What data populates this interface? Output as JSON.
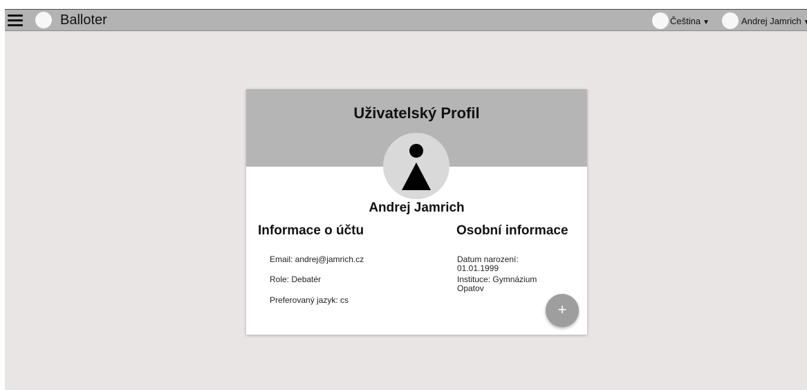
{
  "header": {
    "app_title": "Balloter",
    "language_label": "Čeština",
    "user_label": "Andrej Jamrich",
    "caret": "▼"
  },
  "profile": {
    "title": "Uživatelský Profil",
    "name": "Andrej Jamrich",
    "account_section": {
      "title": "Informace o účtu",
      "email": "Email: andrej@jamrich.cz",
      "role": "Role: Debatér",
      "language": "Preferovaný jazyk: cs"
    },
    "personal_section": {
      "title": "Osobní informace",
      "birth_date": "Datum narození: 01.01.1999",
      "institution": "Instituce: Gymnázium Opatov"
    },
    "fab_label": "+"
  },
  "colors": {
    "topbar": "#b3b3b3",
    "background": "#e8e5e4",
    "card_header": "#b5b5b5",
    "avatar_bg": "#d9d9d9",
    "fab": "#9e9e9e"
  },
  "icons": {
    "menu": "hamburger-icon",
    "logo": "logo-placeholder-icon",
    "language": "language-placeholder-icon",
    "user": "user-placeholder-icon",
    "add": "plus-icon"
  }
}
